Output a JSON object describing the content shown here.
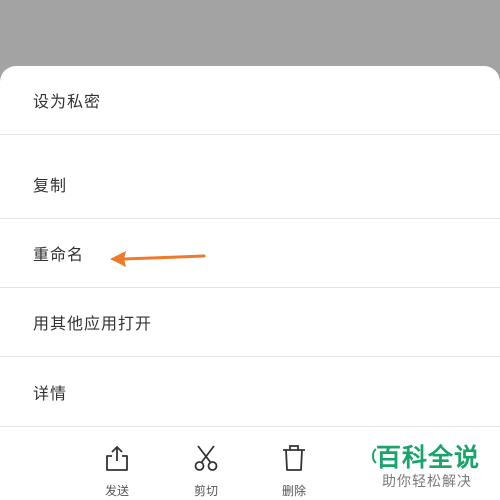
{
  "menu": {
    "items": [
      {
        "label": "设为私密"
      },
      {
        "label": "复制"
      },
      {
        "label": "重命名"
      },
      {
        "label": "用其他应用打开"
      },
      {
        "label": "详情"
      }
    ]
  },
  "toolbar": {
    "items": [
      {
        "label": "发送",
        "icon": "share-icon"
      },
      {
        "label": "剪切",
        "icon": "scissors-icon"
      },
      {
        "label": "删除",
        "icon": "trash-icon"
      }
    ]
  },
  "watermark": {
    "title": "百科全说",
    "subtitle": "助你轻松解决"
  },
  "colors": {
    "arrow": "#f07a2c",
    "watermark": "#1aa36a",
    "overlay": "#a3a3a3"
  }
}
